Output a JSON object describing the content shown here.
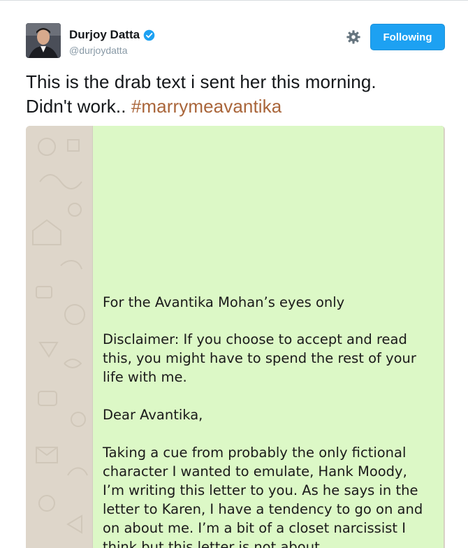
{
  "tweet": {
    "author_name": "Durjoy Datta",
    "author_handle": "@durjoydatta",
    "follow_label": "Following",
    "text_line1": "This is the drab text i sent her this morning.",
    "text_line2_prefix": "Didn't work..",
    "hashtag": "#marrymeavantika"
  },
  "message": {
    "line1": "For the Avantika Mohan’s eyes only",
    "disclaimer": "Disclaimer: If you choose to accept and read this, you might have to spend the rest of your life with me.",
    "salutation": "Dear Avantika,",
    "body": "Taking a cue from probably the only fictional character I wanted to emulate, Hank Moody, I’m writing this letter to you. As he says in the letter to Karen, I have a tendency to go on and on about me. I’m a bit of a closet narcissist I think but this letter is not about"
  },
  "colors": {
    "follow_button": "#1da1f2",
    "hashtag": "#a9653a",
    "bubble": "#dcf8c6",
    "wallpaper": "#ded6ca",
    "verified": "#1da1f2"
  },
  "icons": [
    "verified-badge-icon",
    "gear-icon"
  ]
}
